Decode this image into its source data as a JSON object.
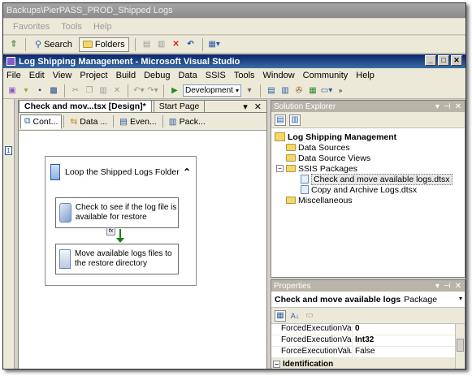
{
  "explorer": {
    "title": "Backups\\PierPASS_PROD_Shipped Logs",
    "menu": [
      "Favorites",
      "Tools",
      "Help"
    ],
    "search_label": "Search",
    "folders_label": "Folders"
  },
  "vs": {
    "title": "Log Shipping Management - Microsoft Visual Studio",
    "menu": [
      "File",
      "Edit",
      "View",
      "Project",
      "Build",
      "Debug",
      "Data",
      "SSIS",
      "Tools",
      "Window",
      "Community",
      "Help"
    ],
    "configuration": "Development"
  },
  "designer": {
    "active_tab": "Check and mov...tsx [Design]*",
    "start_tab": "Start Page",
    "pin": "▾",
    "close": "✕",
    "subtabs": [
      "Cont...",
      "Data ...",
      "Even...",
      "Pack..."
    ],
    "container_title": "Loop the Shipped Logs Folder",
    "collapse": "⌃",
    "task1": "Check to see if the log file is available for restore",
    "task2": "Move available logs files to the restore directory",
    "fx": "fx"
  },
  "solution_explorer": {
    "title": "Solution Explorer",
    "solution": "Log Shipping Management",
    "items": [
      "Data Sources",
      "Data Source Views",
      "SSIS Packages"
    ],
    "packages": [
      "Check and move available logs.dtsx",
      "Copy and Archive Logs.dtsx"
    ],
    "misc": "Miscellaneous"
  },
  "properties": {
    "title": "Properties",
    "object_name": "Check and move available logs",
    "object_type": "Package",
    "rows": [
      {
        "name": "ForcedExecutionValue",
        "value": "0",
        "bold": true
      },
      {
        "name": "ForcedExecutionValueTy",
        "value": "Int32",
        "bold": true
      },
      {
        "name": "ForceExecutionValue",
        "value": "False",
        "bold": false
      }
    ],
    "category": "Identification"
  }
}
